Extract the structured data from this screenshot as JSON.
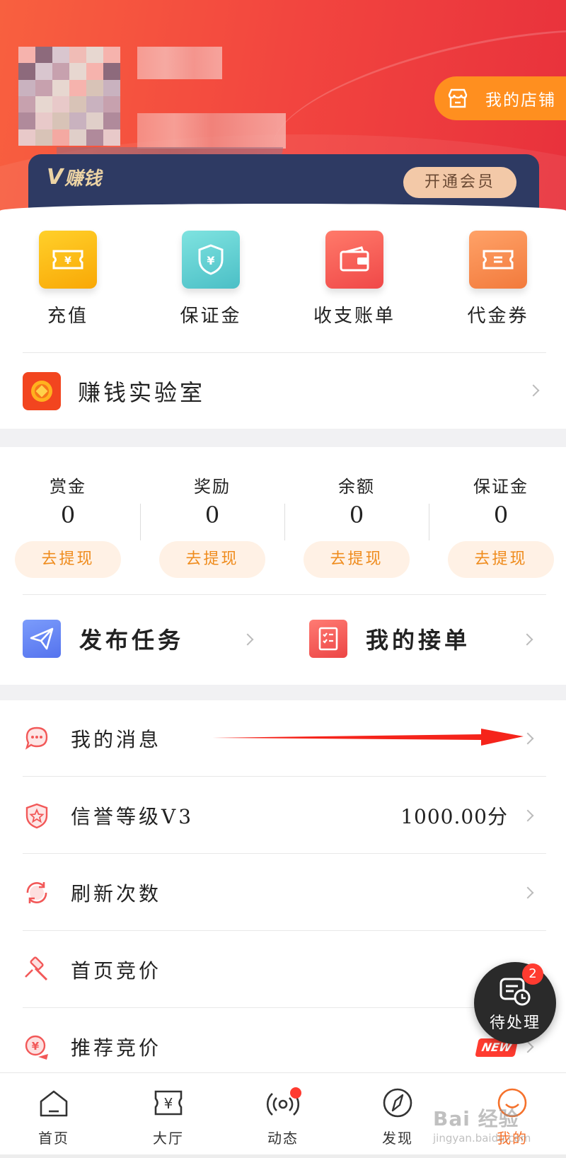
{
  "header": {
    "store_button": "我的店铺",
    "vip_logo_mark": "V",
    "vip_logo_text": "赚钱",
    "vip_button": "开通会员"
  },
  "quick_actions": [
    {
      "label": "充值",
      "icon": "ticket-yuan-icon",
      "color": "#fbb90c"
    },
    {
      "label": "保证金",
      "icon": "shield-yuan-icon",
      "color": "#5ccfcf"
    },
    {
      "label": "收支账单",
      "icon": "wallet-icon",
      "color": "#f55b52"
    },
    {
      "label": "代金券",
      "icon": "coupon-icon",
      "color": "#f9864b"
    }
  ],
  "lab": {
    "label": "赚钱实验室"
  },
  "balances": [
    {
      "label": "赏金",
      "value": "0",
      "button": "去提现"
    },
    {
      "label": "奖励",
      "value": "0",
      "button": "去提现"
    },
    {
      "label": "余额",
      "value": "0",
      "button": "去提现"
    },
    {
      "label": "保证金",
      "value": "0",
      "button": "去提现"
    }
  ],
  "tasks": {
    "publish": "发布任务",
    "my_orders": "我的接单"
  },
  "menu": [
    {
      "label": "我的消息",
      "value": "",
      "icon": "message-bubble-icon"
    },
    {
      "label": "信誉等级V3",
      "value": "1000.00分",
      "icon": "shield-star-icon"
    },
    {
      "label": "刷新次数",
      "value": "",
      "icon": "refresh-icon"
    },
    {
      "label": "首页竞价",
      "value": "",
      "icon": "gavel-icon"
    },
    {
      "label": "推荐竞价",
      "value": "",
      "icon": "yuan-bid-icon"
    }
  ],
  "new_badge": "NEW",
  "floating": {
    "label": "待处理",
    "badge": "2"
  },
  "tabbar": [
    {
      "label": "首页",
      "icon": "home-icon"
    },
    {
      "label": "大厅",
      "icon": "hall-yuan-icon"
    },
    {
      "label": "动态",
      "icon": "broadcast-icon"
    },
    {
      "label": "发现",
      "icon": "compass-icon"
    },
    {
      "label": "我的",
      "icon": "smile-icon",
      "active": true
    }
  ],
  "watermark": {
    "brand": "Bai 经验",
    "url": "jingyan.baidu.com"
  },
  "colors": {
    "accent": "#f5712b",
    "header_red": "#f2453f",
    "store_orange": "#ff8f1f",
    "vip_navy": "#2e3a63",
    "badge_red": "#ff3b30"
  }
}
